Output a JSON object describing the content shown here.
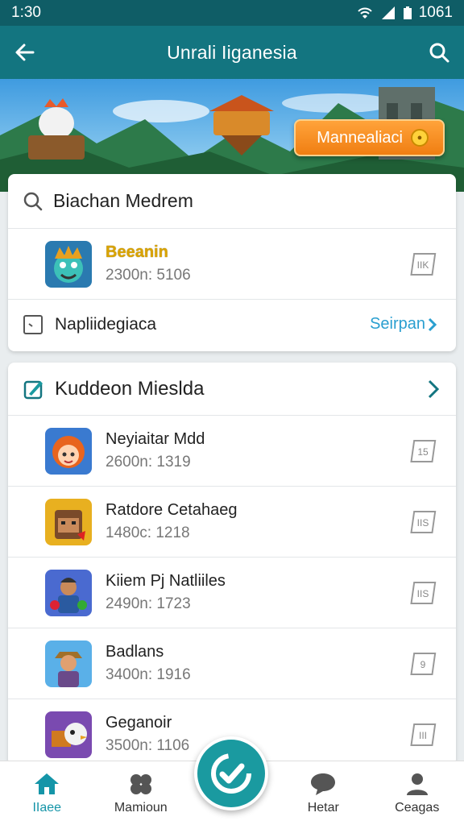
{
  "status_bar": {
    "time": "1:30",
    "right_text": "1061"
  },
  "app_bar": {
    "title": "Unrali Iiganesia"
  },
  "banner": {
    "button_label": "Mannealiaci"
  },
  "search_card": {
    "search_label": "Biachan Medrem",
    "featured_app": {
      "name": "Beeanin",
      "meta": "2300n: 5106",
      "badge": "IIK"
    },
    "more_label": "Napliidegiaca",
    "see_link": "Seirpan"
  },
  "section": {
    "title": "Kuddeon Mieslda",
    "apps": [
      {
        "name": "Neyiaitar Mdd",
        "meta": "2600n: 1319",
        "badge": "15",
        "icon": "girl"
      },
      {
        "name": "Ratdore Cetahaeg",
        "meta": "1480c: 1218",
        "badge": "IIS",
        "icon": "warrior"
      },
      {
        "name": "Kiiem Pj Natliiles",
        "meta": "2490n: 1723",
        "badge": "IIS",
        "icon": "hero"
      },
      {
        "name": "Badlans",
        "meta": "3400n: 1916",
        "badge": "9",
        "icon": "explorer"
      },
      {
        "name": "Geganoir",
        "meta": "3500n: 1106",
        "badge": "III",
        "icon": "bird"
      }
    ]
  },
  "bottom_nav": [
    {
      "label": "IIaee",
      "icon": "home-icon"
    },
    {
      "label": "Mamioun",
      "icon": "community-icon"
    },
    {
      "label": "Hetar",
      "icon": "chat-icon"
    },
    {
      "label": "Ceagas",
      "icon": "profile-icon"
    }
  ],
  "colors": {
    "primary": "#137580",
    "accent": "#1595a8",
    "link": "#2a9fd0",
    "banner_button": "#f58a1f"
  }
}
